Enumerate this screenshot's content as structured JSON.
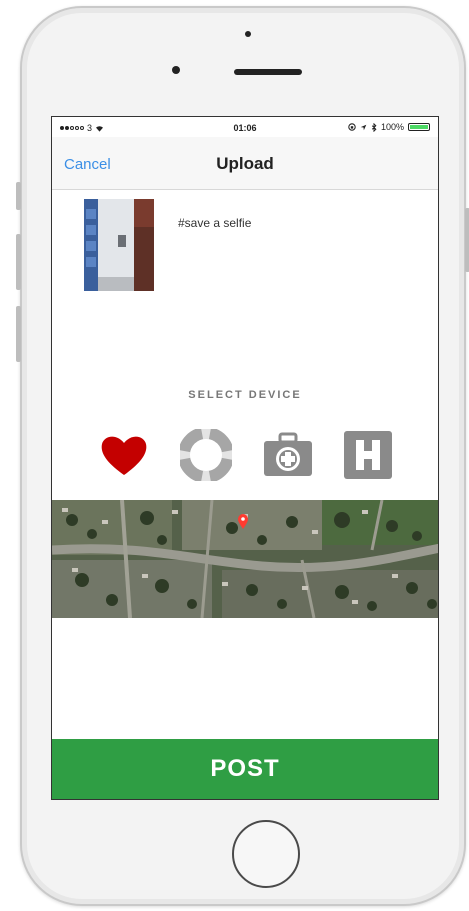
{
  "status_bar": {
    "carrier": "3",
    "time": "01:06",
    "battery": "100%",
    "battery_level": 1.0
  },
  "nav": {
    "cancel_label": "Cancel",
    "title": "Upload"
  },
  "post": {
    "caption": "#save a selfie"
  },
  "device_select": {
    "label": "SELECT DEVICE",
    "options": [
      {
        "icon": "heart-icon",
        "color": "#c40000",
        "selected": true
      },
      {
        "icon": "lifebuoy-icon",
        "color": "#9a9a9a",
        "selected": false
      },
      {
        "icon": "first-aid-kit-icon",
        "color": "#8a8a8a",
        "selected": false
      },
      {
        "icon": "hospital-h-icon",
        "color": "#8a8a8a",
        "selected": false
      }
    ]
  },
  "post_button": {
    "label": "POST",
    "color": "#2f9e44"
  },
  "colors": {
    "link": "#3b8fe6",
    "heart_selected": "#c40000",
    "map_pin": "#ff3b30"
  }
}
